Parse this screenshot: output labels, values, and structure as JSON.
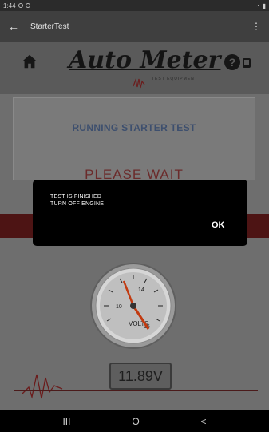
{
  "status_bar": {
    "time": "1:44"
  },
  "app_bar": {
    "title": "StarterTest",
    "back_icon": "back-arrow-icon",
    "menu_icon": "overflow-menu-icon"
  },
  "brand": {
    "logo_text": "Auto Meter",
    "logo_sub": "TEST EQUIPMENT",
    "home_icon": "home-icon",
    "help_icon": "help-icon"
  },
  "test_panel": {
    "status": "RUNNING STARTER TEST",
    "wait": "PLEASE WAIT"
  },
  "gauge": {
    "label": "VOLTS",
    "ticks": [
      "10",
      "14",
      "15"
    ]
  },
  "voltage_display": {
    "value": "11.89V"
  },
  "dialog": {
    "line1": "TEST IS FINISHED",
    "line2": "TURN OFF ENGINE",
    "ok_label": "OK"
  },
  "nav_bar": {
    "recents": "III",
    "home": "O",
    "back": "<"
  },
  "colors": {
    "accent_red": "#4d1414",
    "panel_text": "#3d4f6e"
  }
}
